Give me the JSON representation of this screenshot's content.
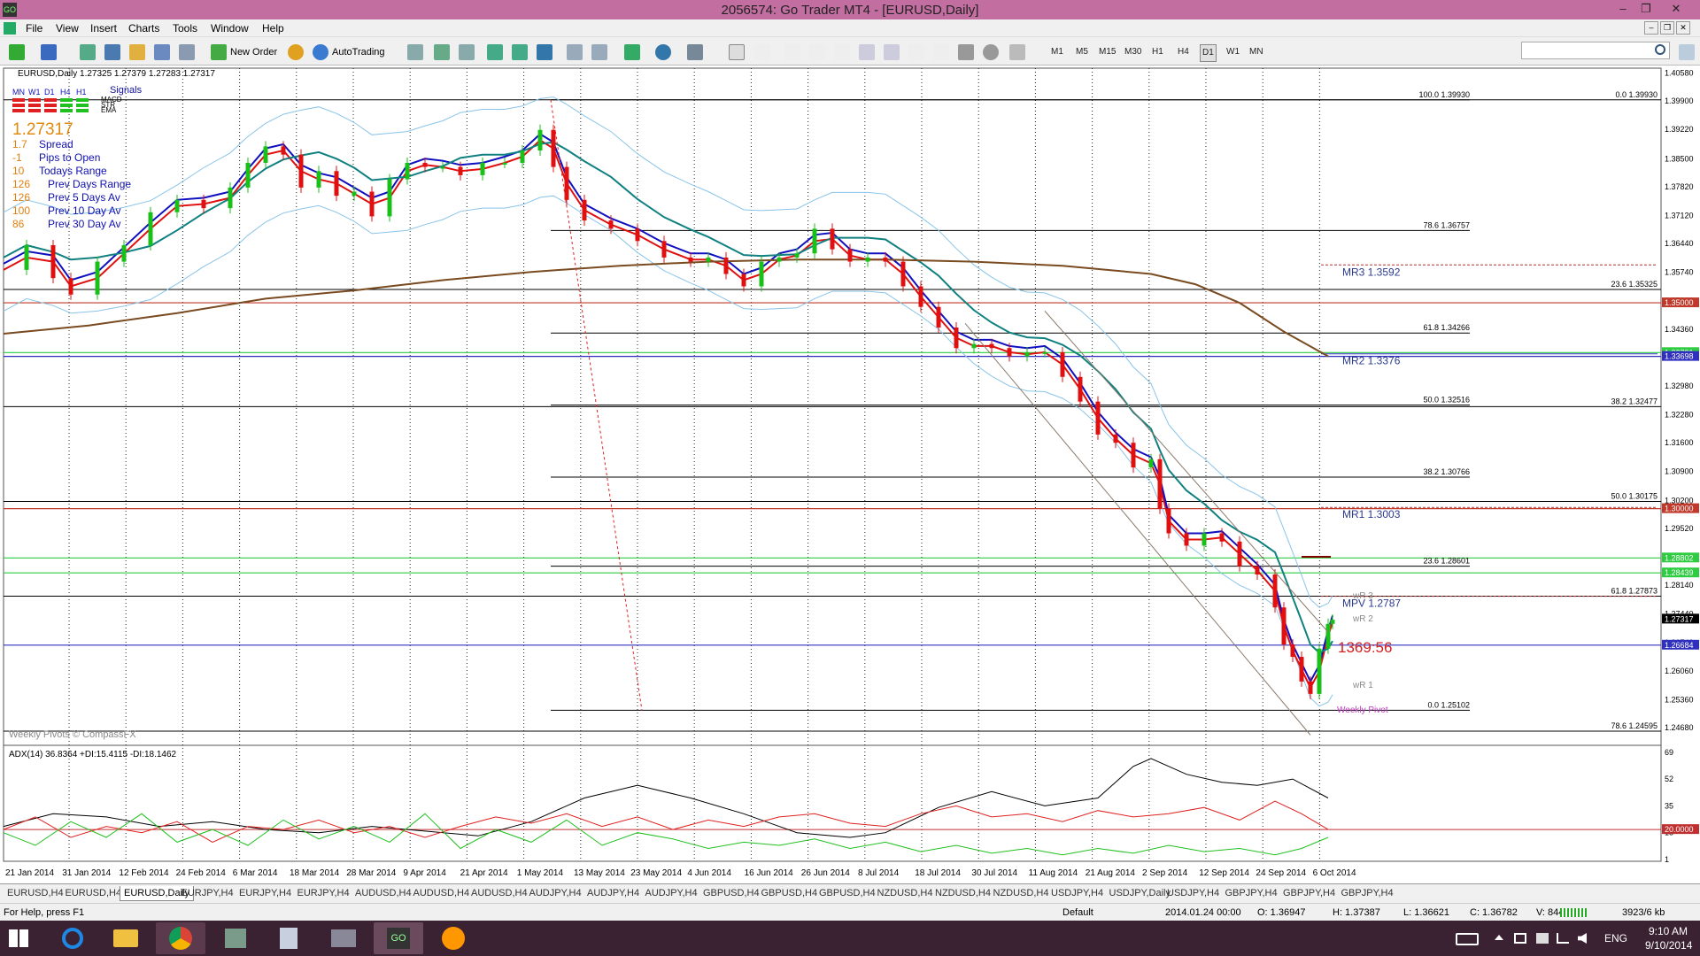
{
  "window": {
    "title": "2056574: Go Trader MT4 - [EURUSD,Daily]",
    "min_glyph": "–",
    "restore_glyph": "❐",
    "close_glyph": "✕"
  },
  "menu": {
    "items": [
      "File",
      "View",
      "Insert",
      "Charts",
      "Tools",
      "Window",
      "Help"
    ]
  },
  "toolbar": {
    "new_order": "New Order",
    "autotrading": "AutoTrading",
    "timeframes": [
      "M1",
      "M5",
      "M15",
      "M30",
      "H1",
      "H4",
      "D1",
      "W1",
      "MN"
    ],
    "active_timeframe": "D1",
    "search_placeholder": ""
  },
  "chart": {
    "header": "EURUSD,Daily  1.27325 1.27379 1.27283 1.27317",
    "signals_title": "Signals",
    "signal_timeframes": [
      "MN",
      "W1",
      "D1",
      "H4",
      "H1"
    ],
    "signal_rows": [
      "MACD",
      "STR",
      "EMA"
    ],
    "price_big": "1.27317",
    "stats": [
      {
        "value": "1.7",
        "label": "Spread"
      },
      {
        "value": "-1",
        "label": "Pips to Open"
      },
      {
        "value": "10",
        "label": "Todays Range"
      },
      {
        "value": "126",
        "label": "Prev Days Range"
      },
      {
        "value": "126",
        "label": "Prev 5 Days Av"
      },
      {
        "value": "100",
        "label": "Prev 10 Day Av"
      },
      {
        "value": "86",
        "label": "Prev 30 Day Av"
      }
    ],
    "footer_note": "Weekly Pivots © CompassFX",
    "countdown": "1369:56",
    "fib_left": [
      {
        "label": "100.0  1.39930",
        "price": 1.3993
      },
      {
        "label": "78.6  1.36757",
        "price": 1.36757
      },
      {
        "label": "61.8  1.34266",
        "price": 1.34266
      },
      {
        "label": "50.0  1.32516",
        "price": 1.32516
      },
      {
        "label": "38.2  1.30766",
        "price": 1.30766
      },
      {
        "label": "23.6  1.28601",
        "price": 1.28601
      },
      {
        "label": "0.0  1.25102",
        "price": 1.25102
      }
    ],
    "fib_right": [
      {
        "label": "0.0  1.39930",
        "price": 1.3993
      },
      {
        "label": "23.6  1.35325",
        "price": 1.35325
      },
      {
        "label": "38.2  1.32477",
        "price": 1.32477
      },
      {
        "label": "50.0  1.30175",
        "price": 1.30175
      },
      {
        "label": "61.8  1.27873",
        "price": 1.27873
      },
      {
        "label": "78.6  1.24595",
        "price": 1.24595
      }
    ],
    "pivots": [
      {
        "label": "MR3   1.3592",
        "price": 1.3592
      },
      {
        "label": "MR2   1.3376",
        "price": 1.3376
      },
      {
        "label": "MR1   1.3003",
        "price": 1.3003
      },
      {
        "label": "MPV   1.2787",
        "price": 1.2787
      }
    ],
    "weekly_labels": [
      "wR 3",
      "wR 2",
      "wR 1",
      "Weekly Pivot"
    ],
    "price_axis_ticks": [
      "1.40580",
      "1.39900",
      "1.39220",
      "1.38500",
      "1.37820",
      "1.37120",
      "1.36440",
      "1.35740",
      "1.35060",
      "1.34360",
      "1.33660",
      "1.32980",
      "1.32280",
      "1.31600",
      "1.30900",
      "1.30200",
      "1.29520",
      "1.28140",
      "1.27440",
      "1.26740",
      "1.26060",
      "1.25360",
      "1.24680"
    ],
    "price_axis_ticks_values": [
      1.4058,
      1.399,
      1.3922,
      1.385,
      1.3782,
      1.3712,
      1.3644,
      1.3574,
      1.3506,
      1.3436,
      1.3366,
      1.3298,
      1.3228,
      1.316,
      1.309,
      1.302,
      1.2952,
      1.2814,
      1.2744,
      1.2674,
      1.2606,
      1.2536,
      1.2468
    ],
    "price_boxes": [
      {
        "label": "1.35000",
        "price": 1.35,
        "color": "#c0392b"
      },
      {
        "label": "1.33791",
        "price": 1.33791,
        "color": "#2ecc40"
      },
      {
        "label": "1.33698",
        "price": 1.33698,
        "color": "#3030c0"
      },
      {
        "label": "1.30000",
        "price": 1.3,
        "color": "#c0392b"
      },
      {
        "label": "1.28802",
        "price": 1.28802,
        "color": "#2ecc40"
      },
      {
        "label": "1.28439",
        "price": 1.28439,
        "color": "#2ecc40"
      },
      {
        "label": "1.27317",
        "price": 1.27317,
        "color": "#000000"
      },
      {
        "label": "1.26684",
        "price": 1.26684,
        "color": "#3030c0"
      }
    ],
    "price_range": [
      1.2425,
      1.407
    ]
  },
  "adx": {
    "header": "ADX(14) 36.8364 +DI:15.4115 -DI:18.1462",
    "axis_ticks": [
      "69",
      "52",
      "35",
      "18",
      "1"
    ],
    "axis_values": [
      69,
      52,
      35,
      18,
      1
    ],
    "level_box": "20.0000",
    "level": 20
  },
  "date_axis": [
    "21 Jan 2014",
    "31 Jan 2014",
    "12 Feb 2014",
    "24 Feb 2014",
    "6 Mar 2014",
    "18 Mar 2014",
    "28 Mar 2014",
    "9 Apr 2014",
    "21 Apr 2014",
    "1 May 2014",
    "13 May 2014",
    "23 May 2014",
    "4 Jun 2014",
    "16 Jun 2014",
    "26 Jun 2014",
    "8 Jul 2014",
    "18 Jul 2014",
    "30 Jul 2014",
    "11 Aug 2014",
    "21 Aug 2014",
    "2 Sep 2014",
    "12 Sep 2014",
    "24 Sep 2014",
    "6 Oct 2014"
  ],
  "tabs": [
    "EURUSD,H4",
    "EURUSD,H4",
    "EURUSD,Daily",
    "EURJPY,H4",
    "EURJPY,H4",
    "EURJPY,H4",
    "AUDUSD,H4",
    "AUDUSD,H4",
    "AUDUSD,H4",
    "AUDJPY,H4",
    "AUDJPY,H4",
    "AUDJPY,H4",
    "GBPUSD,H4",
    "GBPUSD,H4",
    "GBPUSD,H4",
    "NZDUSD,H4",
    "NZDUSD,H4",
    "NZDUSD,H4",
    "USDJPY,H4",
    "USDJPY,Daily",
    "USDJPY,H4",
    "GBPJPY,H4",
    "GBPJPY,H4",
    "GBPJPY,H4"
  ],
  "active_tab": 2,
  "status": {
    "help": "For Help, press F1",
    "profile": "Default",
    "datetime": "2014.01.24 00:00",
    "open": "O: 1.36947",
    "high": "H: 1.37387",
    "low": "L: 1.36621",
    "close": "C: 1.36782",
    "volume": "V: 84476",
    "traffic": "3923/6 kb"
  },
  "taskbar": {
    "lang": "ENG",
    "time": "9:10 AM",
    "date": "9/10/2014",
    "colors": {
      "ie": "#1e88e5",
      "explorer": "#f0c040",
      "chrome": "#db4437",
      "accent": "#ff9800"
    }
  }
}
